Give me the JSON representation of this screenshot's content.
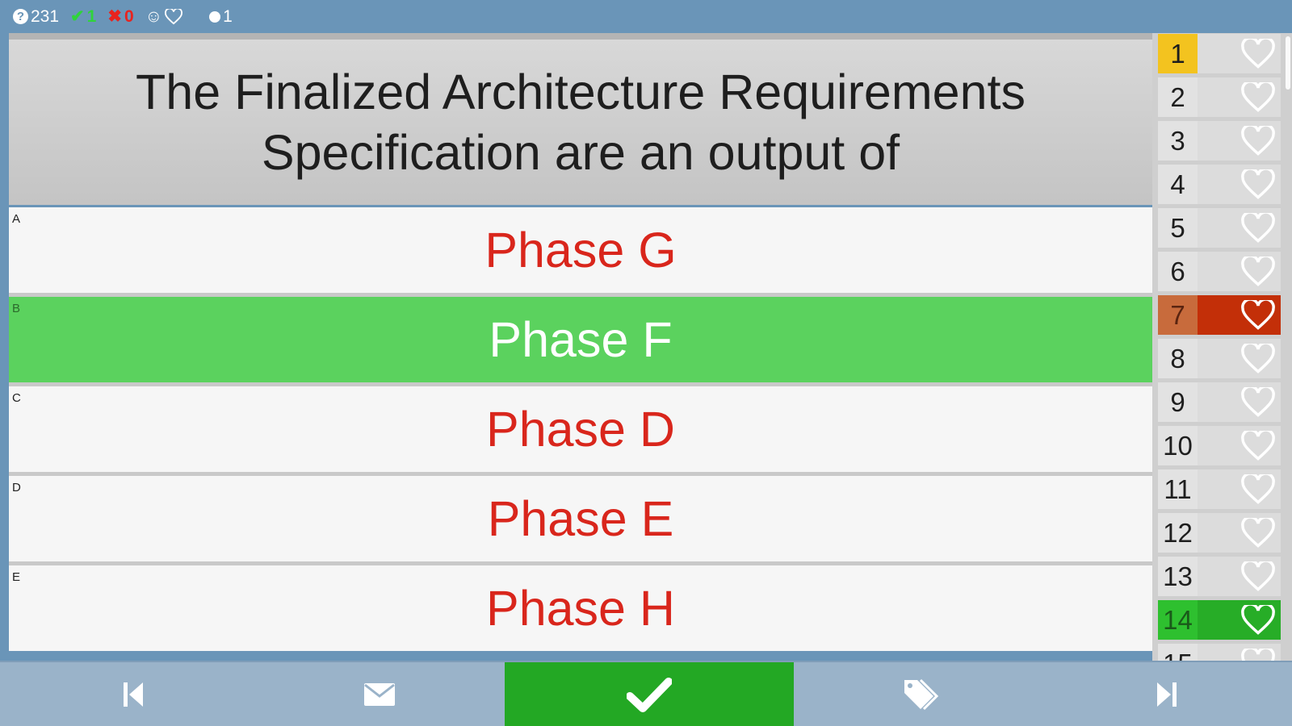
{
  "status": {
    "total_questions": "231",
    "correct_count": "1",
    "wrong_count": "0",
    "marked_count": "1"
  },
  "question": {
    "text": "The Finalized Architecture Requirements Specification are an output of"
  },
  "answers": [
    {
      "letter": "A",
      "text": "Phase G",
      "selected": false
    },
    {
      "letter": "B",
      "text": "Phase F",
      "selected": true
    },
    {
      "letter": "C",
      "text": "Phase D",
      "selected": false
    },
    {
      "letter": "D",
      "text": "Phase E",
      "selected": false
    },
    {
      "letter": "E",
      "text": "Phase H",
      "selected": false
    }
  ],
  "question_list": [
    {
      "num": "1",
      "state": "current"
    },
    {
      "num": "2",
      "state": "unanswered"
    },
    {
      "num": "3",
      "state": "unanswered"
    },
    {
      "num": "4",
      "state": "unanswered"
    },
    {
      "num": "5",
      "state": "unanswered"
    },
    {
      "num": "6",
      "state": "unanswered"
    },
    {
      "num": "7",
      "state": "wrong"
    },
    {
      "num": "8",
      "state": "unanswered"
    },
    {
      "num": "9",
      "state": "unanswered"
    },
    {
      "num": "10",
      "state": "unanswered"
    },
    {
      "num": "11",
      "state": "unanswered"
    },
    {
      "num": "12",
      "state": "unanswered"
    },
    {
      "num": "13",
      "state": "unanswered"
    },
    {
      "num": "14",
      "state": "right"
    },
    {
      "num": "15",
      "state": "unanswered"
    }
  ],
  "toolbar": {
    "buttons": [
      "first-question-icon",
      "mail-icon",
      "check-icon",
      "tag-icon",
      "last-question-icon"
    ]
  },
  "colors": {
    "accent_blue": "#6a95b8",
    "correct_green": "#5bd25e",
    "submit_green": "#23a824",
    "answer_red": "#d9261c",
    "wrong_red": "#c32f08",
    "current_yellow": "#f3c31f"
  }
}
